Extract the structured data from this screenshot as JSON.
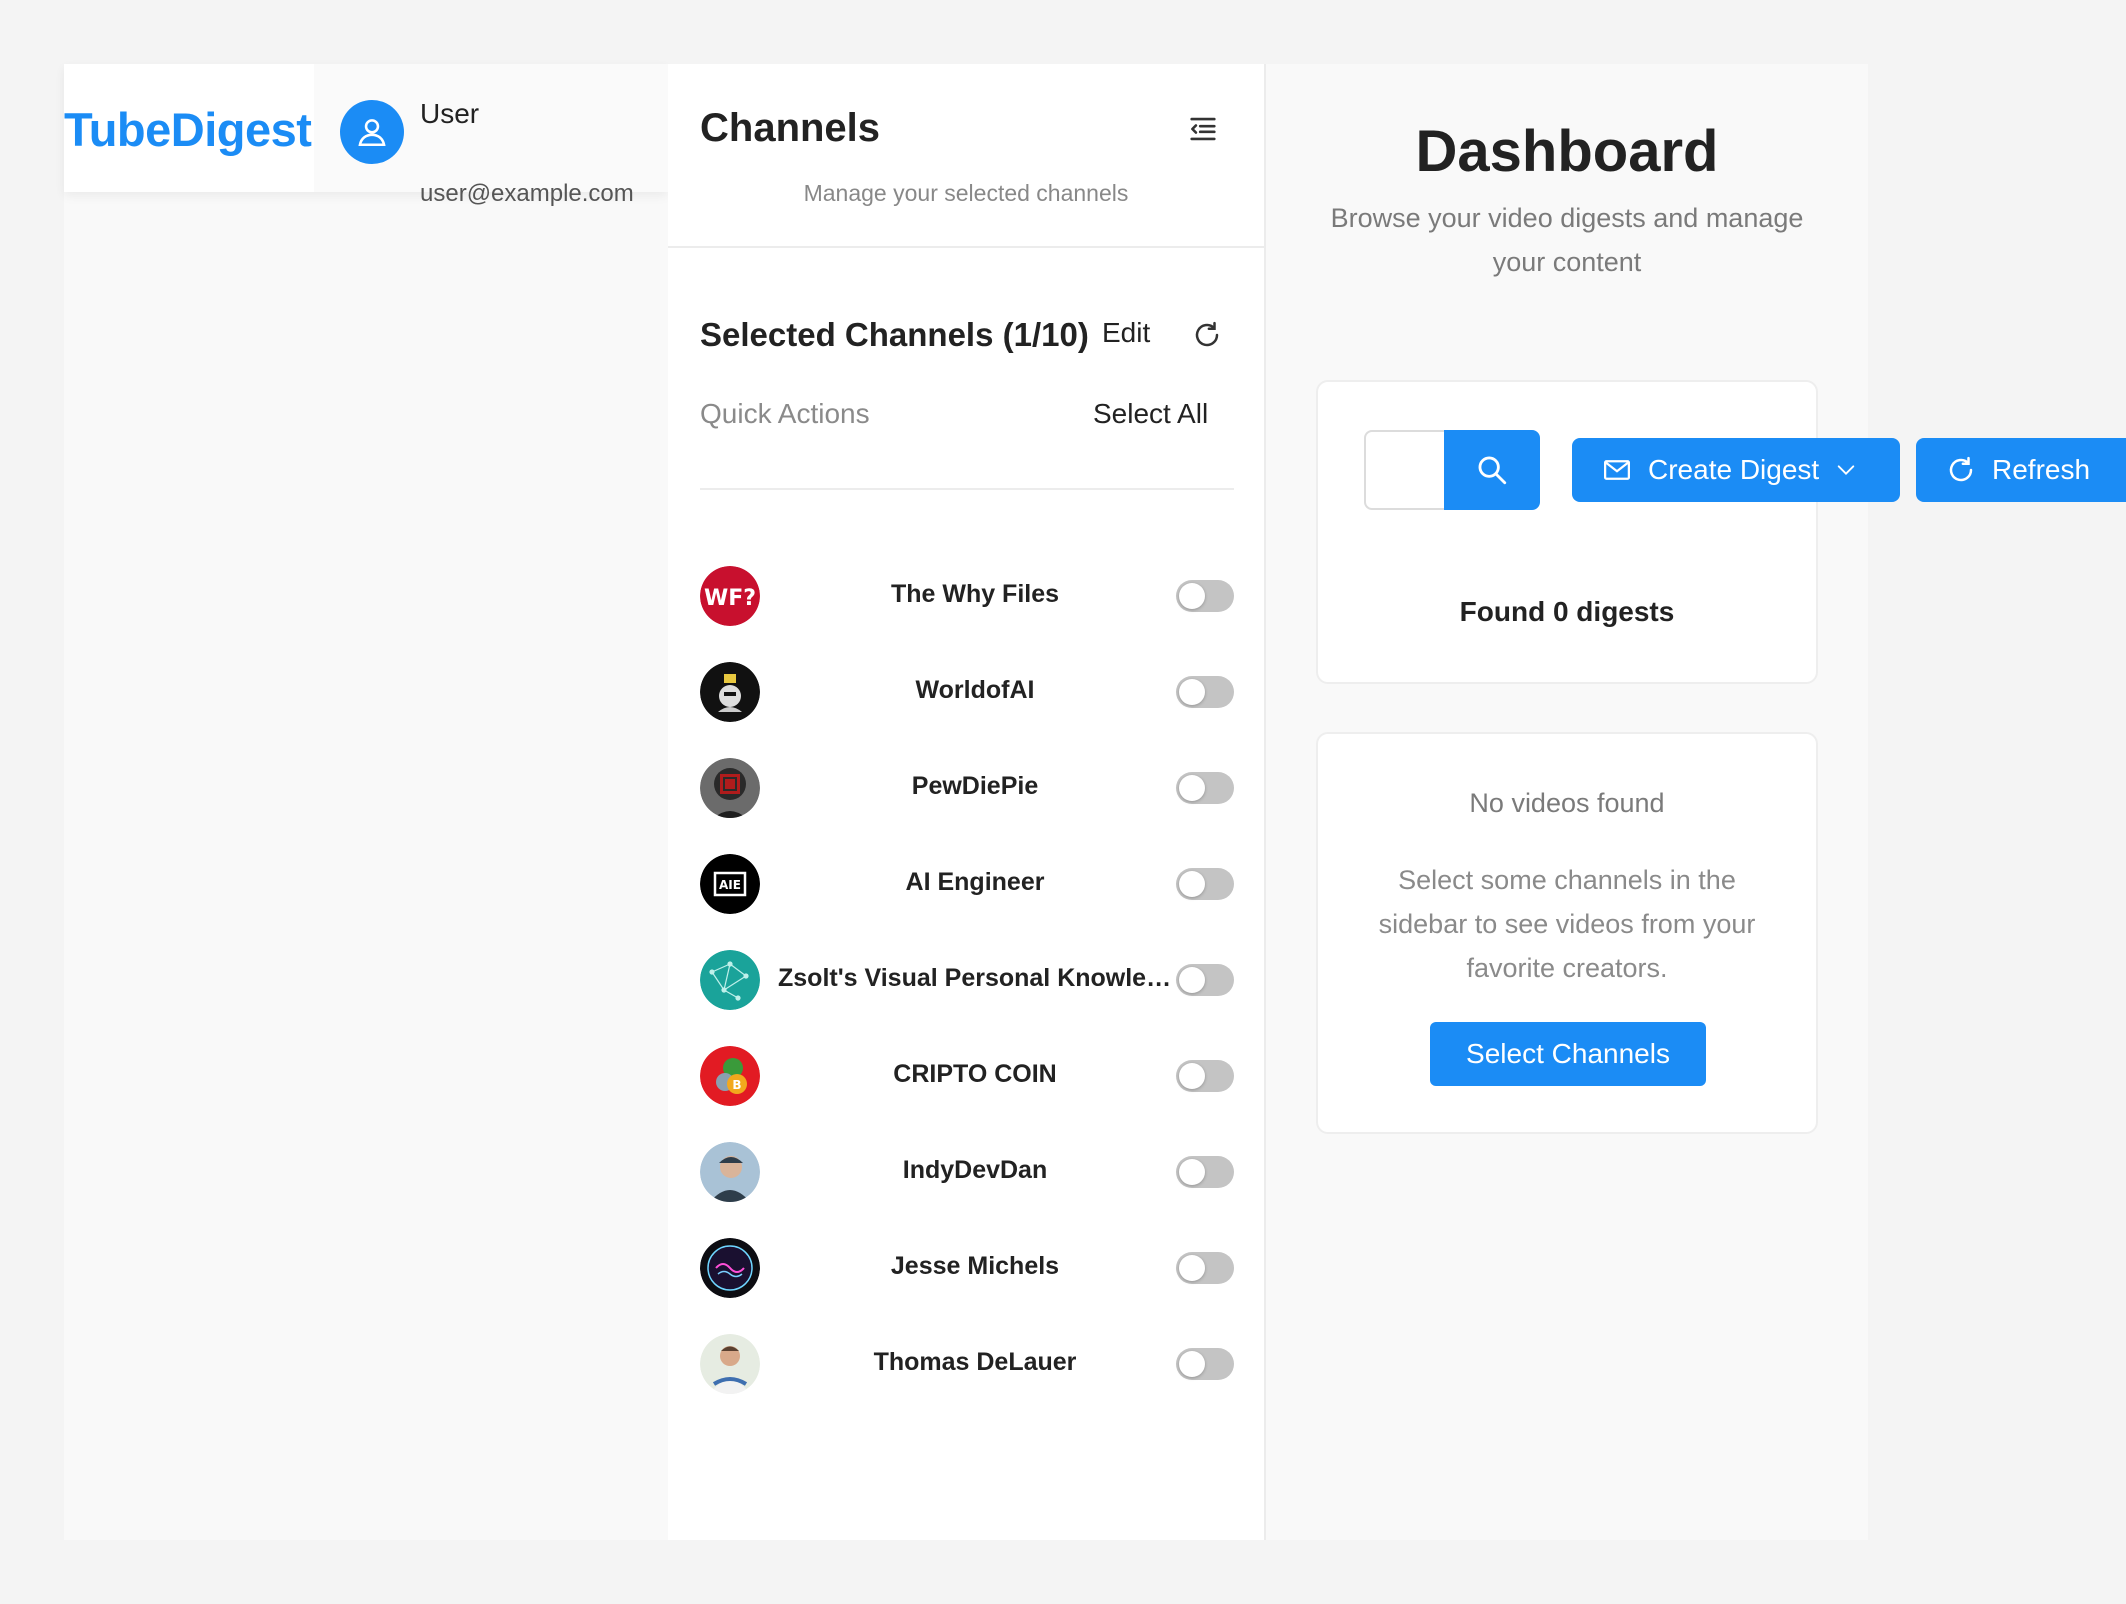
{
  "app": {
    "name": "TubeDigest"
  },
  "user": {
    "name": "User",
    "email": "user@example.com"
  },
  "sidebar": {
    "title": "Channels",
    "subtitle": "Manage your selected channels",
    "selected_title": "Selected Channels (1/10)",
    "edit_label": "Edit",
    "quick_actions_label": "Quick Actions",
    "select_all_label": "Select All",
    "channels": [
      {
        "name": "The Why Files",
        "enabled": false,
        "avatar": "wf-logo",
        "avatar_color": "#c8102e"
      },
      {
        "name": "WorldofAI",
        "enabled": false,
        "avatar": "robot-logo",
        "avatar_color": "#111111"
      },
      {
        "name": "PewDiePie",
        "enabled": false,
        "avatar": "pewdiepie-logo",
        "avatar_color": "#555555"
      },
      {
        "name": "AI Engineer",
        "enabled": false,
        "avatar": "aie-logo",
        "avatar_color": "#000000"
      },
      {
        "name": "Zsolt's Visual Personal Knowledge Management",
        "enabled": false,
        "avatar": "network-logo",
        "avatar_color": "#1aa39a"
      },
      {
        "name": "CRIPTO COIN",
        "enabled": false,
        "avatar": "coin-logo",
        "avatar_color": "#e21b23"
      },
      {
        "name": "IndyDevDan",
        "enabled": false,
        "avatar": "person-photo",
        "avatar_color": "#4a6b82"
      },
      {
        "name": "Jesse Michels",
        "enabled": false,
        "avatar": "neon-logo",
        "avatar_color": "#1a1030"
      },
      {
        "name": "Thomas DeLauer",
        "enabled": false,
        "avatar": "person-photo",
        "avatar_color": "#7a9ab8"
      }
    ]
  },
  "dashboard": {
    "title": "Dashboard",
    "subtitle": "Browse your video digests and manage your content",
    "search_placeholder": "",
    "create_digest_label": "Create Digest",
    "refresh_label": "Refresh",
    "found_text": "Found 0 digests",
    "empty_title": "No videos found",
    "empty_description": "Select some channels in the sidebar to see videos from your favorite creators.",
    "select_channels_label": "Select Channels"
  },
  "colors": {
    "accent": "#1b8cf5",
    "toggle_off": "#c4c4c4"
  }
}
